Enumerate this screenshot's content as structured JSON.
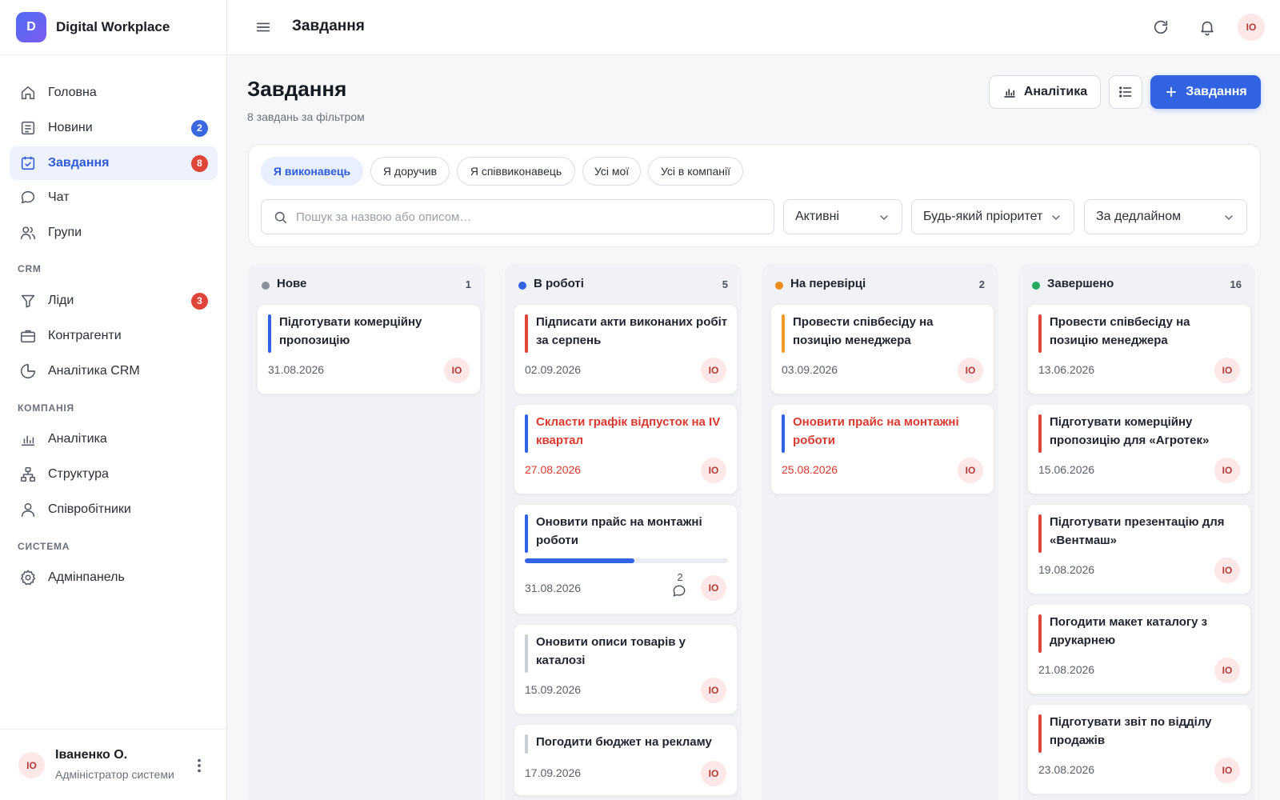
{
  "brand": {
    "logo_letter": "D",
    "name": "Digital Workplace"
  },
  "sidebar": {
    "items": [
      {
        "label": "Головна",
        "icon": "home-icon",
        "badge": ""
      },
      {
        "label": "Новини",
        "icon": "news-icon",
        "badge": "2"
      },
      {
        "label": "Завдання",
        "icon": "tasks-icon",
        "badge": "8"
      },
      {
        "label": "Чат",
        "icon": "chat-icon",
        "badge": ""
      },
      {
        "label": "Групи",
        "icon": "groups-icon",
        "badge": ""
      },
      {
        "label": "Ліди",
        "icon": "funnel-icon",
        "badge": "3"
      },
      {
        "label": "Контрагенти",
        "icon": "briefcase-icon",
        "badge": ""
      },
      {
        "label": "Аналітика CRM",
        "icon": "pie-chart-icon",
        "badge": ""
      },
      {
        "label": "Аналітика",
        "icon": "bar-chart-icon",
        "badge": ""
      },
      {
        "label": "Структура",
        "icon": "structure-icon",
        "badge": ""
      },
      {
        "label": "Співробітники",
        "icon": "user-icon",
        "badge": ""
      },
      {
        "label": "Адмінпанель",
        "icon": "gear-icon",
        "badge": ""
      }
    ],
    "sections": {
      "crm": "CRM",
      "company": "КОМПАНІЯ",
      "system": "СИСТЕМА"
    },
    "active_item": "Завдання"
  },
  "user": {
    "initials": "ІО",
    "name": "Іваненко О.",
    "role": "Адміністратор системи"
  },
  "topbar": {
    "title": "Завдання",
    "avatar_initials": "ІО"
  },
  "header": {
    "title": "Завдання",
    "subtitle": "8 завдань за фільтром",
    "analytics_label": "Аналітика",
    "new_task_label": "Завдання"
  },
  "filters": {
    "chips": [
      "Я виконавець",
      "Я доручив",
      "Я співвиконавець",
      "Усі мої",
      "Усі в компанії"
    ],
    "active_chip": "Я виконавець",
    "search_placeholder": "Пошук за назвою або описом…",
    "status": "Активні",
    "priority": "Будь-який пріоритет",
    "sort": "За дедлайном"
  },
  "colors": {
    "accent": "#3263e3",
    "overdue": "#d9392f",
    "status_new": "#8a909b",
    "status_in_progress": "#3263e3",
    "status_review": "#f08c1c",
    "status_done": "#22a861",
    "bar_blue": "#3263e3",
    "bar_red": "#e0453a",
    "bar_orange": "#f09a2a",
    "bar_gray": "#c9cdd4"
  },
  "board": {
    "columns": [
      {
        "title": "Нове",
        "count": "1",
        "dot": "status_new",
        "cards": [
          {
            "title": "Підготувати комерційну пропозицію",
            "date": "31.08.2026",
            "bar": "bar_blue",
            "overdue": false,
            "assignee": "ІО"
          }
        ]
      },
      {
        "title": "В роботі",
        "count": "5",
        "dot": "status_in_progress",
        "cards": [
          {
            "title": "Підписати акти виконаних робіт за серпень",
            "date": "02.09.2026",
            "bar": "bar_red",
            "overdue": false,
            "assignee": "ІО"
          },
          {
            "title": "Скласти графік відпусток на IV квартал",
            "date": "27.08.2026",
            "bar": "bar_blue",
            "overdue": true,
            "assignee": "ІО"
          },
          {
            "title": "Оновити прайс на монтажні роботи",
            "date": "31.08.2026",
            "bar": "bar_blue",
            "overdue": false,
            "assignee": "ІО",
            "progress": 0.54,
            "comments": "2"
          },
          {
            "title": "Оновити описи товарів у каталозі",
            "date": "15.09.2026",
            "bar": "bar_gray",
            "overdue": false,
            "assignee": "ІО"
          },
          {
            "title": "Погодити бюджет на рекламу",
            "date": "17.09.2026",
            "bar": "bar_gray",
            "overdue": false,
            "assignee": "ІО"
          }
        ]
      },
      {
        "title": "На перевірці",
        "count": "2",
        "dot": "status_review",
        "cards": [
          {
            "title": "Провести співбесіду на позицію менеджера",
            "date": "03.09.2026",
            "bar": "bar_orange",
            "overdue": false,
            "assignee": "ІО"
          },
          {
            "title": "Оновити прайс на монтажні роботи",
            "date": "25.08.2026",
            "bar": "bar_blue",
            "overdue": true,
            "assignee": "ІО"
          }
        ]
      },
      {
        "title": "Завершено",
        "count": "16",
        "dot": "status_done",
        "cards": [
          {
            "title": "Провести співбесіду на позицію менеджера",
            "date": "13.06.2026",
            "bar": "bar_red",
            "overdue": false,
            "assignee": "ІО"
          },
          {
            "title": "Підготувати комерційну пропозицію для «Агротек»",
            "date": "15.06.2026",
            "bar": "bar_red",
            "overdue": false,
            "assignee": "ІО"
          },
          {
            "title": "Підготувати презентацію для «Вентмаш»",
            "date": "19.08.2026",
            "bar": "bar_red",
            "overdue": false,
            "assignee": "ІО"
          },
          {
            "title": "Погодити макет каталогу з друкарнею",
            "date": "21.08.2026",
            "bar": "bar_red",
            "overdue": false,
            "assignee": "ІО"
          },
          {
            "title": "Підготувати звіт по відділу продажів",
            "date": "23.08.2026",
            "bar": "bar_red",
            "overdue": false,
            "assignee": "ІО"
          }
        ]
      }
    ]
  }
}
